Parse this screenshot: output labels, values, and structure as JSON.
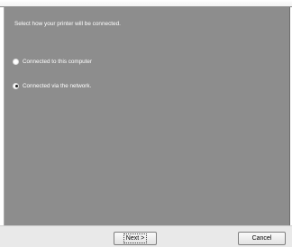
{
  "panel": {
    "instruction": "Select how your printer will be connected.",
    "options": [
      {
        "label": "Connected to this computer",
        "selected": false
      },
      {
        "label": "Connected via the network.",
        "selected": true
      }
    ]
  },
  "buttons": {
    "next_label": "Next >",
    "cancel_label": "Cancel"
  }
}
